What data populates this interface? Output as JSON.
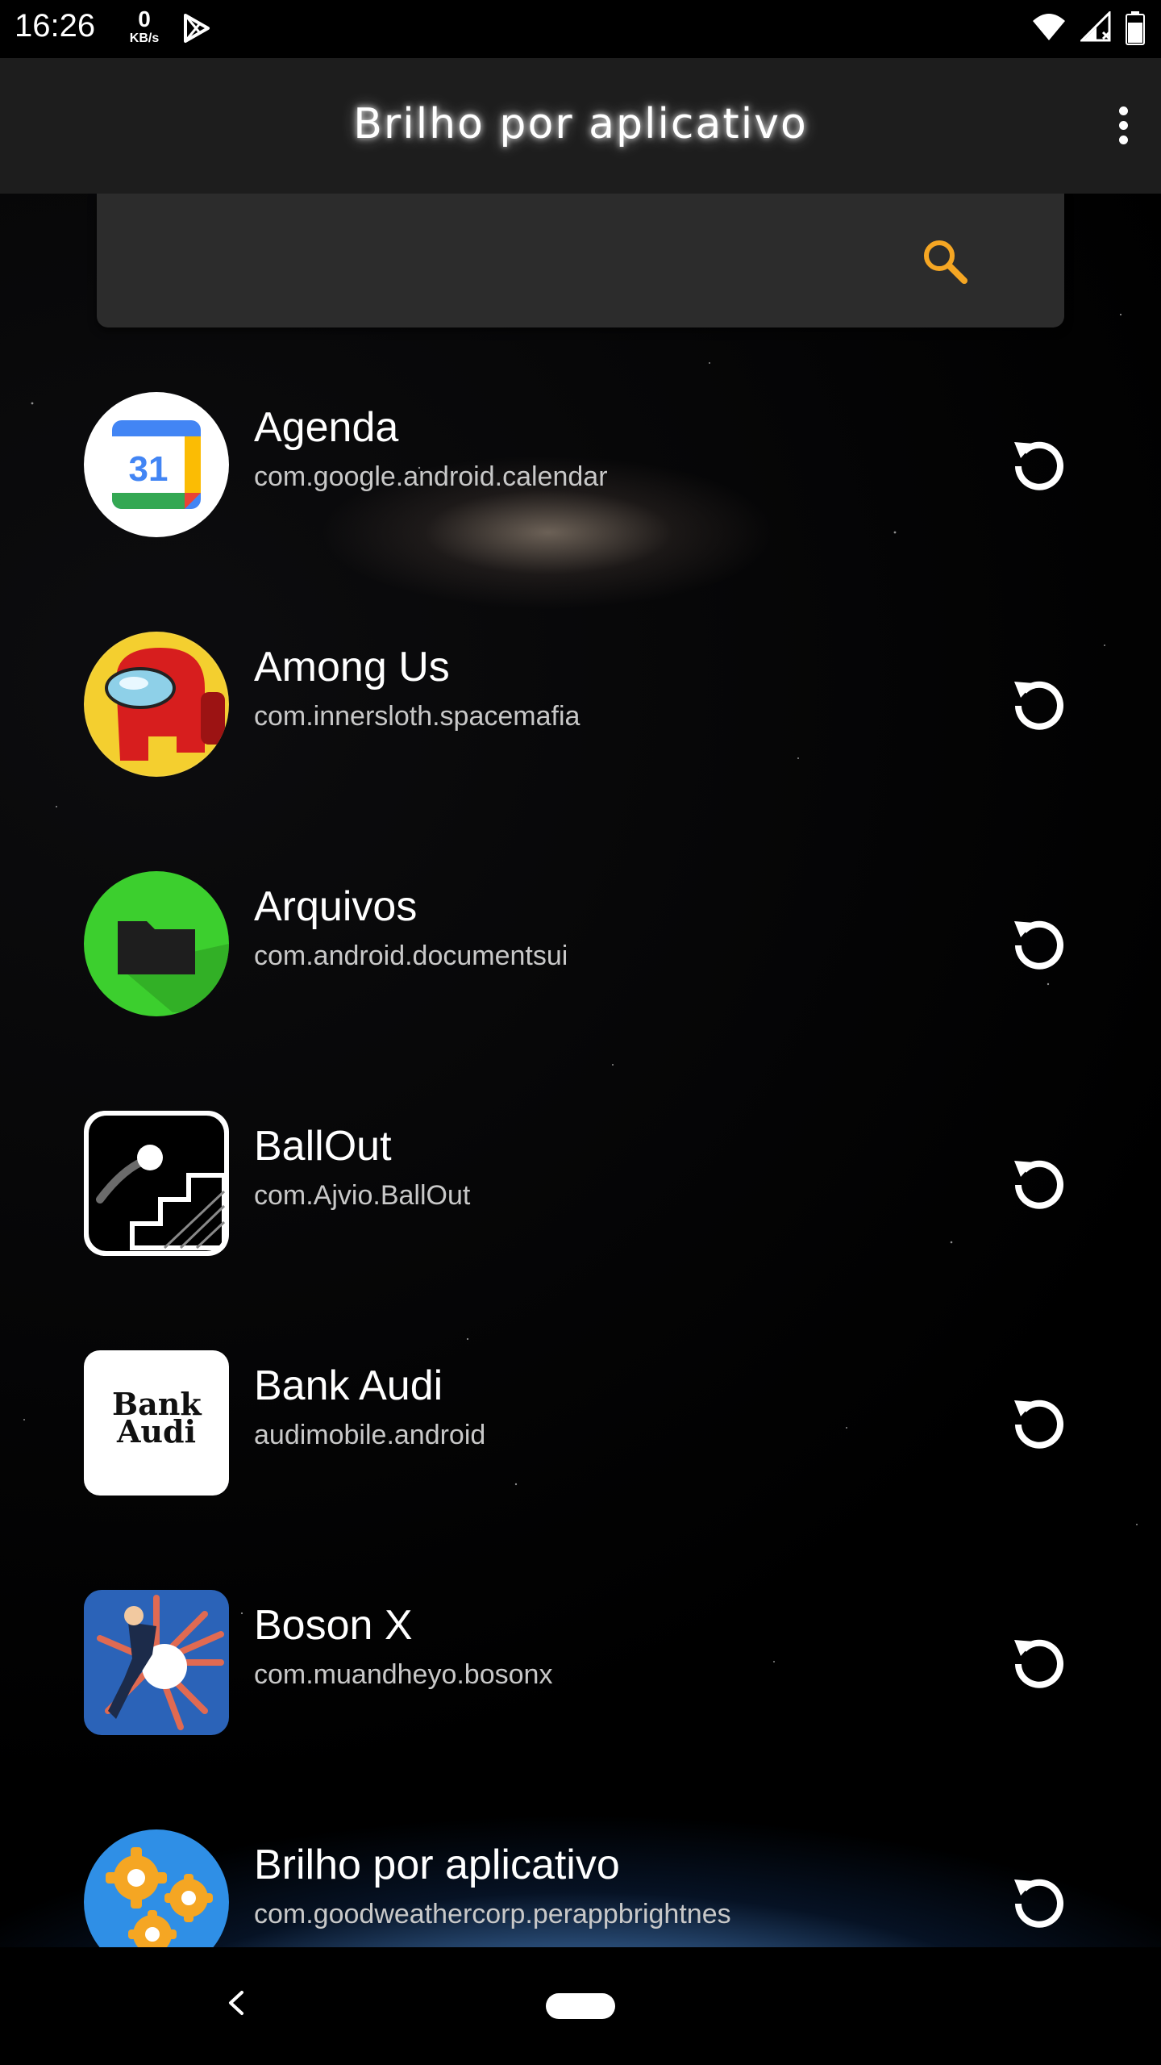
{
  "status_bar": {
    "time": "16:26",
    "net_speed_value": "0",
    "net_speed_unit": "KB/s"
  },
  "toolbar": {
    "title": "Brilho por aplicativo"
  },
  "search": {
    "placeholder": "",
    "value": ""
  },
  "colors": {
    "accent": "#f5a623",
    "toolbar_bg": "#1d1d1d",
    "search_bg": "#2c2c2c"
  },
  "apps": [
    {
      "name": "Agenda",
      "package": "com.google.android.calendar",
      "icon": "calendar-icon"
    },
    {
      "name": "Among Us",
      "package": "com.innersloth.spacemafia",
      "icon": "among-us-icon"
    },
    {
      "name": "Arquivos",
      "package": "com.android.documentsui",
      "icon": "folder-icon"
    },
    {
      "name": "BallOut",
      "package": "com.Ajvio.BallOut",
      "icon": "ballout-icon"
    },
    {
      "name": "Bank Audi",
      "package": "audimobile.android",
      "icon": "bank-audi-icon",
      "logo_text": "Bank Audi"
    },
    {
      "name": "Boson X",
      "package": "com.muandheyo.bosonx",
      "icon": "boson-x-icon"
    },
    {
      "name": "Brilho por aplicativo",
      "package": "com.goodweathercorp.perappbrightnes",
      "icon": "gears-icon"
    }
  ],
  "calendar_day": "31"
}
